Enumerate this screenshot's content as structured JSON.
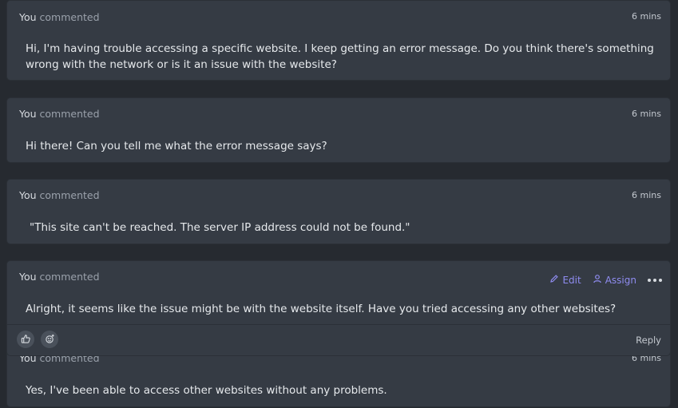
{
  "comments": [
    {
      "author": "You",
      "verb": "commented",
      "time": "6 mins",
      "text": "Hi, I'm having trouble accessing a specific website. I keep getting an  error message. Do you think there's something wrong with the network or  is it an issue with the website?"
    },
    {
      "author": "You",
      "verb": "commented",
      "time": "6 mins",
      "text": "Hi there! Can you tell me what the error message says?"
    },
    {
      "author": "You",
      "verb": "commented",
      "time": "6 mins",
      "text": "\"This site can't be reached. The server IP address could not be found.\""
    },
    {
      "author": "You",
      "verb": "commented",
      "text": "Alright, it seems like the issue might be with the website itself. Have you tried accessing any other websites?",
      "actions": {
        "edit_label": "Edit",
        "assign_label": "Assign"
      },
      "footer": {
        "reply_label": "Reply"
      }
    },
    {
      "author": "You",
      "verb": "commented",
      "time": "6 mins",
      "text": "Yes, I've been able to access other websites without any problems."
    }
  ],
  "icons": {
    "edit": "pencil-icon",
    "assign": "user-icon",
    "more": "more-dots-icon",
    "like": "thumbs-up-icon",
    "reaction": "add-reaction-icon"
  },
  "colors": {
    "background": "#262a30",
    "card": "#353b44",
    "accent": "#8f8cf0"
  }
}
